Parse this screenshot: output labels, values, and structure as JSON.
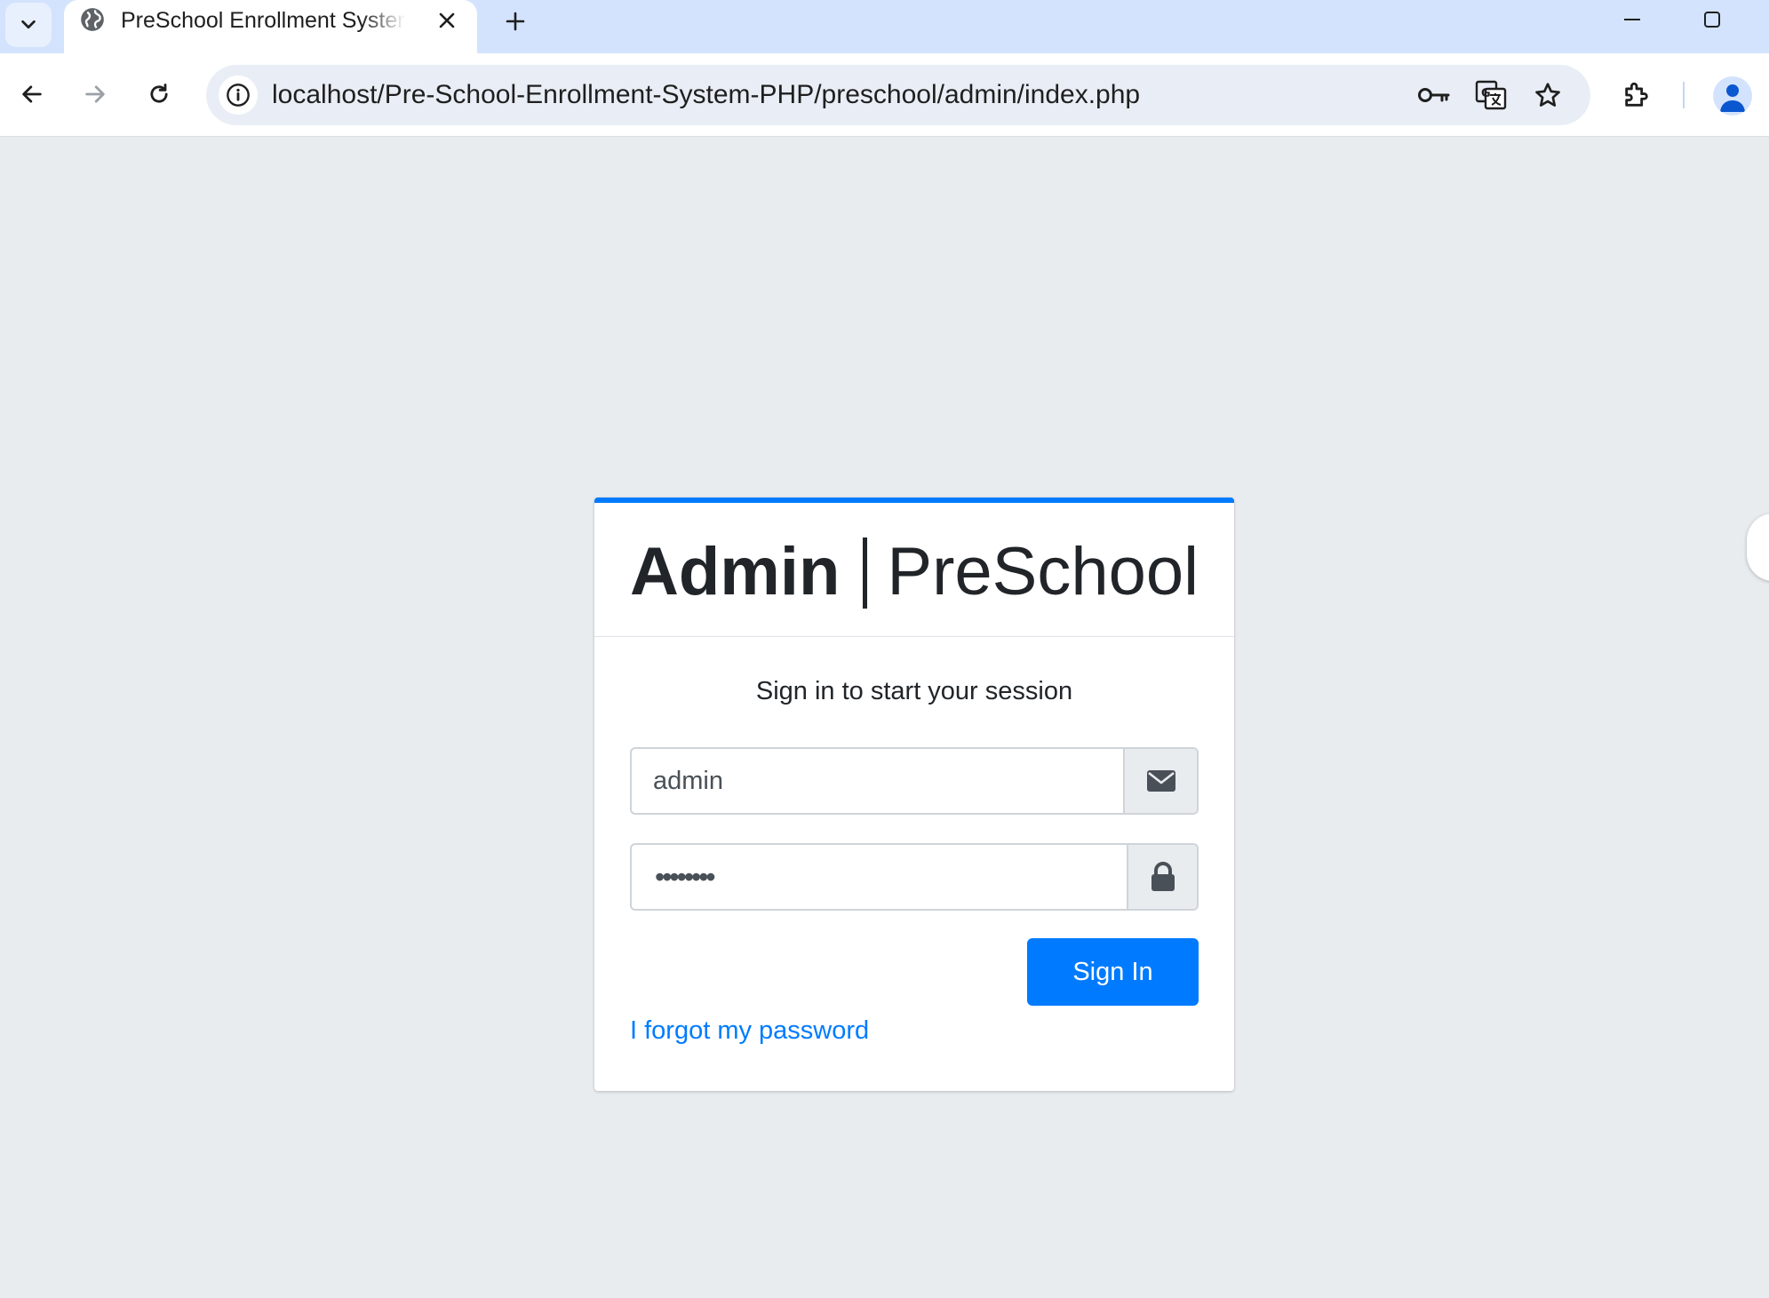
{
  "browser": {
    "tab_title": "PreSchool Enrollment System",
    "url": "localhost/Pre-School-Enrollment-System-PHP/preschool/admin/index.php",
    "icons": {
      "tab_menu": "chevron-down-icon",
      "favicon": "globe-icon",
      "tab_close": "close-icon",
      "new_tab": "plus-icon",
      "minimize": "minimize-icon",
      "maximize": "maximize-icon",
      "back": "arrow-left-icon",
      "forward": "arrow-right-icon",
      "reload": "reload-icon",
      "site_info": "info-icon",
      "password": "key-icon",
      "translate": "translate-icon",
      "bookmark": "star-icon",
      "extensions": "puzzle-icon",
      "profile": "person-icon"
    }
  },
  "login": {
    "logo_bold": "Admin",
    "logo_light": "PreSchool",
    "message": "Sign in to start your session",
    "username_value": "admin",
    "password_value": "••••••••",
    "username_icon": "envelope-icon",
    "password_icon": "lock-icon",
    "signin_label": "Sign In",
    "forgot_label": "I forgot my password"
  },
  "colors": {
    "primary": "#007bff",
    "page_background": "#e9ecef",
    "tab_strip": "#d3e3fd",
    "text": "#212529"
  }
}
